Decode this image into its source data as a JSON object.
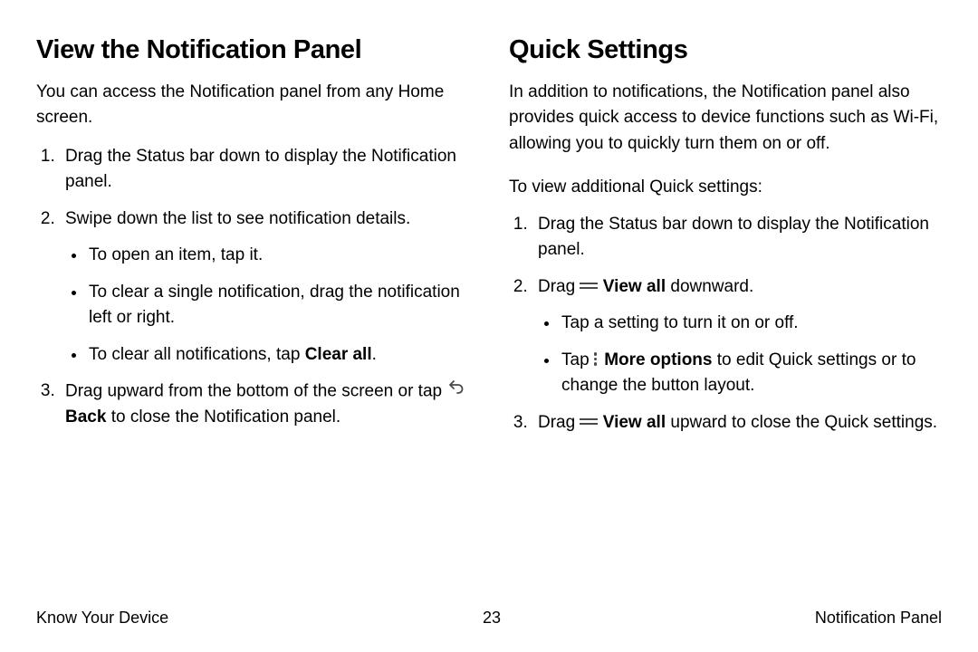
{
  "left": {
    "heading": "View the Notification Panel",
    "intro": "You can access the Notification panel from any Home screen.",
    "step1": "Drag the Status bar down to display the Notification panel.",
    "step2": "Swipe down the list to see notification details.",
    "step2_a": "To open an item, tap it.",
    "step2_b": "To clear a single notification, drag the notification left or right.",
    "step2_c_pre": "To clear all notifications, tap ",
    "step2_c_bold": "Clear all",
    "step2_c_post": ".",
    "step3_pre": "Drag upward from the bottom of the screen or tap ",
    "step3_bold": "Back",
    "step3_post": " to close the Notification panel."
  },
  "right": {
    "heading": "Quick Settings",
    "intro": "In addition to notifications, the Notification panel also provides quick access to device functions such as Wi-Fi, allowing you to quickly turn them on or off.",
    "sub": "To view additional Quick settings:",
    "step1": "Drag the Status bar down to display the Notification panel.",
    "step2_pre": "Drag ",
    "step2_bold": "View all",
    "step2_post": " downward.",
    "step2_a": "Tap a setting to turn it on or off.",
    "step2_b_pre": "Tap ",
    "step2_b_bold": "More options",
    "step2_b_post": " to edit Quick settings or to change the button layout.",
    "step3_pre": "Drag ",
    "step3_bold": "View all",
    "step3_post": " upward to close the Quick settings."
  },
  "footer": {
    "left": "Know Your Device",
    "center": "23",
    "right": "Notification Panel"
  }
}
